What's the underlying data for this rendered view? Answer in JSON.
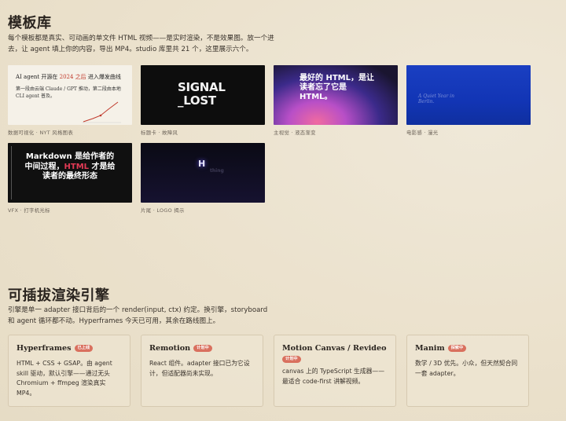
{
  "templates": {
    "title": "模板库",
    "description": "每个模板都是真实、可动画的单文件 HTML 视频——是实时渲染，不是效果图。放一个进去，让 agent 填上你的内容，导出 MP4。studio 库里共 21 个，这里展示六个。",
    "items": [
      {
        "caption": "数据可视化 · NYT 风格图表",
        "thumb": {
          "line1_pre": "AI agent 开源在 ",
          "line1_year": "2024",
          "line1_num": " 之后",
          "line1_post": " 进入爆发曲线",
          "line2": "第一段由云端 Claude / GPT 推动，第二段由本地 CLI agent 普及。"
        }
      },
      {
        "caption": "标题卡 · 故障风",
        "thumb": {
          "line1": "SIGNAL",
          "line2": "_LOST"
        }
      },
      {
        "caption": "主视觉 · 液态渐变",
        "thumb": {
          "text": "最好的 HTML，是让读者忘了它是 HTML。"
        }
      },
      {
        "caption": "电影感 · 漫光",
        "thumb": {
          "text": "A Quiet Year in Berlin."
        }
      },
      {
        "caption": "VFX · 打字机光标",
        "thumb": {
          "pre": "Markdown 是给作者的中间过程，",
          "accent": "HTML",
          "post": " 才是给读者的最终形态"
        }
      },
      {
        "caption": "片尾 · LOGO 揭示",
        "thumb": {
          "glyph": "H",
          "ghost": "thing"
        }
      }
    ]
  },
  "engines": {
    "title": "可插拔渲染引擎",
    "description": "引擎是单一 adapter 接口背后的一个 render(input, ctx) 约定。换引擎，storyboard 和 agent 循环都不动。Hyperframes 今天已可用，其余在路线图上。",
    "adapters": [
      {
        "name": "Hyperframes",
        "badge": "已上线",
        "description": "HTML + CSS + GSAP。由 agent skill 驱动，默认引擎——通过无头 Chromium + ffmpeg 渲染真实 MP4。"
      },
      {
        "name": "Remotion",
        "badge": "计划中",
        "description": "React 组件。adapter 接口已为它设计，但适配器尚未实现。"
      },
      {
        "name": "Motion Canvas / Revideo",
        "badge": "计划中",
        "description": "canvas 上的 TypeScript 生成器——最适合 code-first 讲解视频。"
      },
      {
        "name": "Manim",
        "badge": "探索中",
        "description": "数学 / 3D 优先。小众，但天然契合同一套 adapter。"
      }
    ]
  },
  "colors": {
    "background": "#ece3cf",
    "badge": "#d9705e",
    "accent_red": "#e23a55"
  }
}
